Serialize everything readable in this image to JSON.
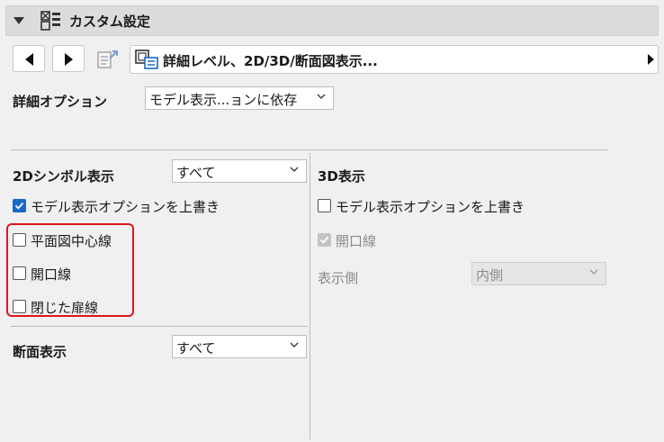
{
  "header": {
    "title": "カスタム設定",
    "icon": "custom-settings-icon"
  },
  "navigation": {
    "back_icon": "arrow-left-icon",
    "forward_icon": "arrow-right-icon",
    "document_icon": "document-export-icon",
    "panel_selector": {
      "label": "詳細レベル、2D/3D/断面図表示...",
      "icon": "panel-view-icon"
    }
  },
  "detail_option": {
    "label": "詳細オプション",
    "value": "モデル表示...ョンに依存"
  },
  "symbol_2d": {
    "label": "2Dシンボル表示",
    "value": "すべて",
    "override": {
      "label": "モデル表示オプションを上書き",
      "checked": true
    },
    "options": [
      {
        "label": "平面図中心線",
        "checked": false
      },
      {
        "label": "開口線",
        "checked": false
      },
      {
        "label": "閉じた扉線",
        "checked": false
      }
    ]
  },
  "section_view": {
    "label": "断面表示",
    "value": "すべて"
  },
  "display_3d": {
    "label": "3D表示",
    "override": {
      "label": "モデル表示オプションを上書き",
      "checked": false
    },
    "opening_line": {
      "label": "開口線",
      "checked": true,
      "disabled": true
    },
    "display_side": {
      "label": "表示側",
      "value": "内側",
      "disabled": true
    }
  },
  "colors": {
    "highlight": "#e0141e",
    "checkbox_checked": "#1a68c8"
  }
}
